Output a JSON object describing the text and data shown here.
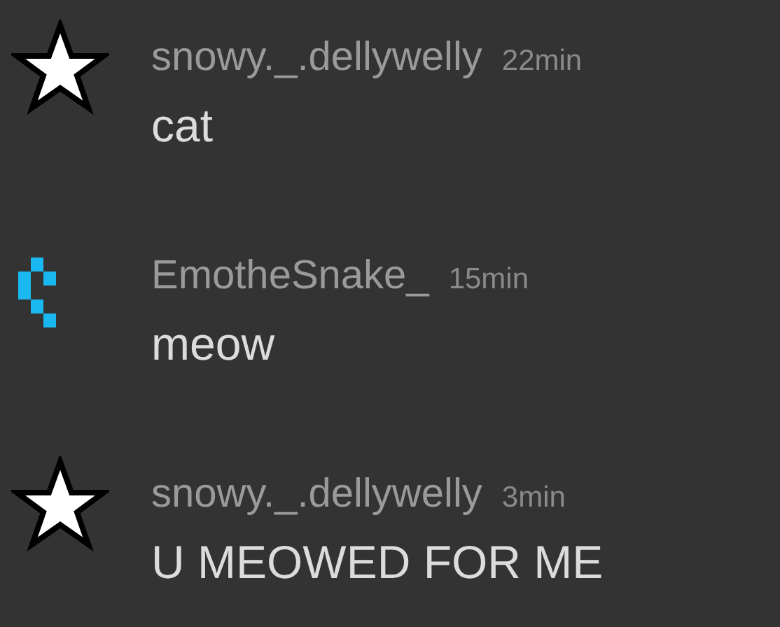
{
  "messages": [
    {
      "avatar": {
        "kind": "star"
      },
      "username": "snowy._.dellywelly",
      "time": "22min",
      "text": "cat"
    },
    {
      "avatar": {
        "kind": "pixel"
      },
      "username": "EmotheSnake_",
      "time": "15min",
      "text": "meow"
    },
    {
      "avatar": {
        "kind": "star"
      },
      "username": "snowy._.dellywelly",
      "time": "3min",
      "text": "U MEOWED FOR ME"
    }
  ]
}
